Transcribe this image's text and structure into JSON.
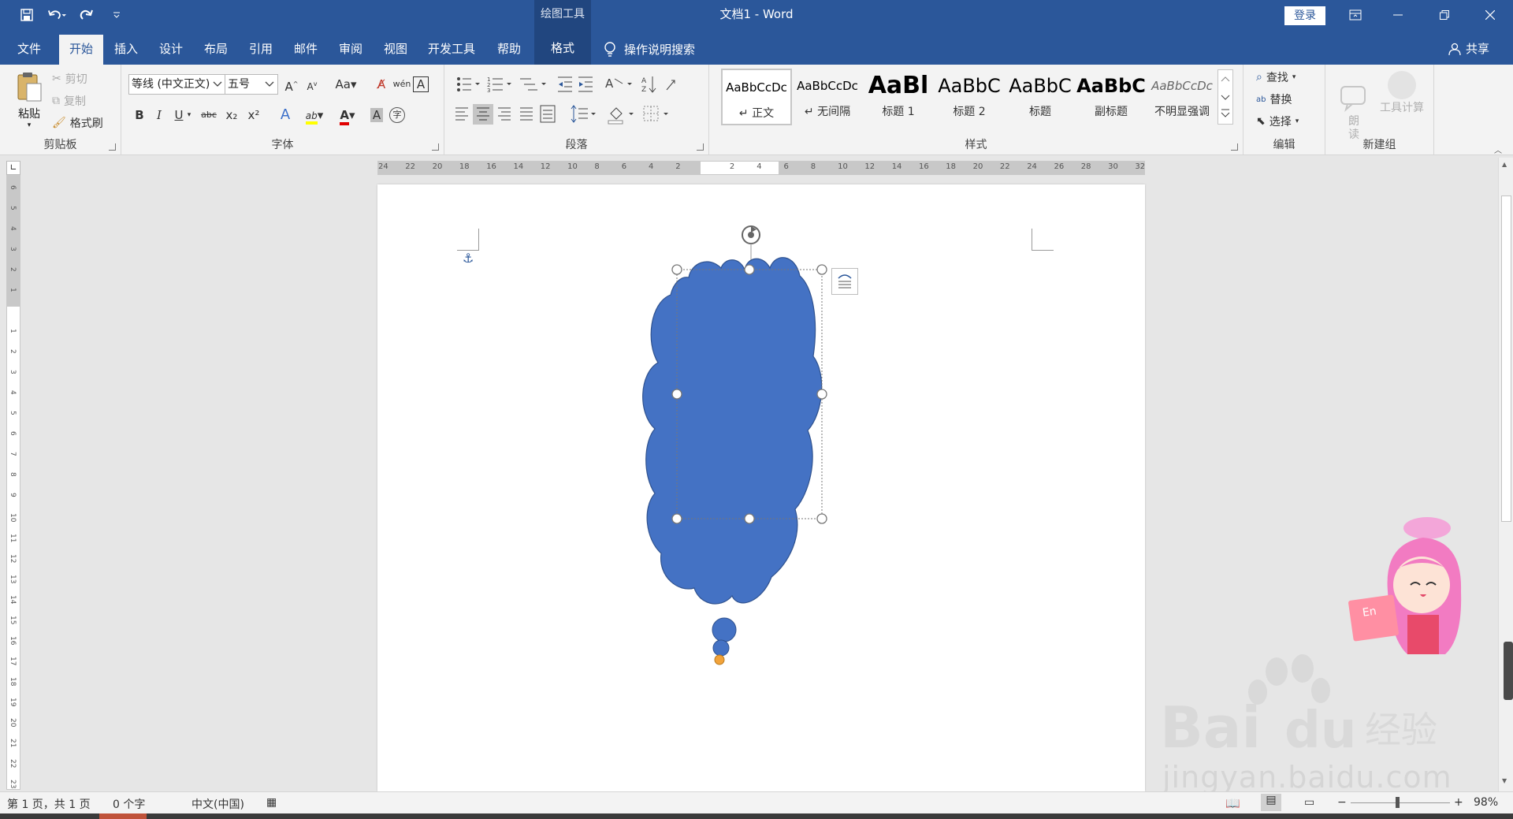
{
  "window": {
    "title": "文档1  -  Word",
    "context_tab_group": "绘图工具",
    "login_label": "登录"
  },
  "tabs": [
    "文件",
    "开始",
    "插入",
    "设计",
    "布局",
    "引用",
    "邮件",
    "审阅",
    "视图",
    "开发工具",
    "帮助",
    "格式"
  ],
  "active_tab": "开始",
  "tell_me": "操作说明搜索",
  "share": "共享",
  "clipboard": {
    "paste": "粘贴",
    "cut": "剪切",
    "copy": "复制",
    "format_painter": "格式刷",
    "label": "剪贴板"
  },
  "font": {
    "name": "等线 (中文正文)",
    "size": "五号",
    "label": "字体",
    "grow": "A",
    "shrink": "A",
    "case": "Aa",
    "bold": "B",
    "italic": "I",
    "underline": "U",
    "strike": "abc",
    "subscript": "x₂",
    "superscript": "x²",
    "effects": "A",
    "highlight": "ab",
    "color": "A",
    "shading": "A",
    "wen": "wén",
    "encircle": "A",
    "enclose": "字"
  },
  "paragraph": {
    "label": "段落"
  },
  "styles": {
    "label": "样式",
    "items": [
      {
        "preview": "AaBbCcDc",
        "name": "↵ 正文"
      },
      {
        "preview": "AaBbCcDc",
        "name": "↵ 无间隔"
      },
      {
        "preview": "AaBl",
        "name": "标题 1"
      },
      {
        "preview": "AaBbC",
        "name": "标题 2"
      },
      {
        "preview": "AaBbC",
        "name": "标题"
      },
      {
        "preview": "AaBbC",
        "name": "副标题"
      },
      {
        "preview": "AaBbCcDc",
        "name": "不明显强调"
      }
    ]
  },
  "editing": {
    "label": "编辑",
    "find": "查找",
    "replace": "替换",
    "select": "选择"
  },
  "new_group": {
    "label": "新建组",
    "read_aloud": "朗\n读",
    "tool_calc": "工具计算"
  },
  "ruler": {
    "h_ticks": [
      "24",
      "22",
      "20",
      "18",
      "16",
      "14",
      "12",
      "10",
      "8",
      "6",
      "4",
      "2",
      "",
      "2",
      "4",
      "6",
      "8",
      "10",
      "12",
      "14",
      "16",
      "18",
      "20",
      "22",
      "24",
      "26",
      "28",
      "30",
      "32"
    ],
    "v_ticks": [
      "6",
      "5",
      "4",
      "3",
      "2",
      "1",
      "",
      "1",
      "2",
      "3",
      "4",
      "5",
      "6",
      "7",
      "8",
      "9",
      "10",
      "11",
      "12",
      "13",
      "14",
      "15",
      "16",
      "17",
      "18",
      "19",
      "20",
      "21",
      "22",
      "23"
    ]
  },
  "status": {
    "page": "第 1 页，共 1 页",
    "words": "0 个字",
    "language": "中文(中国)",
    "zoom": "98%"
  },
  "colors": {
    "title_bar": "#2b579a",
    "shape_fill": "#4472c4",
    "shape_stroke": "#2f528f",
    "adjust_handle": "#f2a33a"
  },
  "watermark": {
    "text": "jingyan.baidu.com"
  }
}
